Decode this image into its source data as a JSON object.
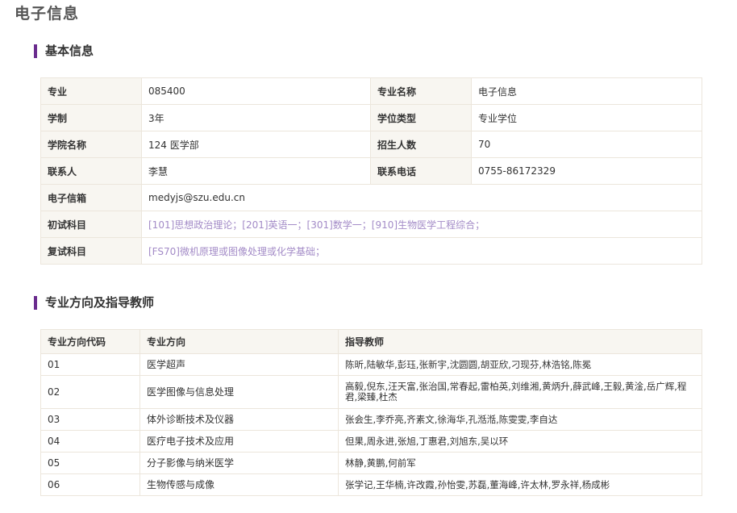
{
  "page": {
    "title": "电子信息"
  },
  "basic_info": {
    "section_title": "基本信息",
    "major_label": "专业",
    "major_value": "085400",
    "major_name_label": "专业名称",
    "major_name_value": "电子信息",
    "duration_label": "学制",
    "duration_value": "3年",
    "degree_type_label": "学位类型",
    "degree_type_value": "专业学位",
    "college_label": "学院名称",
    "college_value": "124 医学部",
    "enrollment_label": "招生人数",
    "enrollment_value": "70",
    "contact_label": "联系人",
    "contact_value": "李慧",
    "phone_label": "联系电话",
    "phone_value": "0755-86172329",
    "email_label": "电子信箱",
    "email_value": "medyjs@szu.edu.cn",
    "prelim_label": "初试科目",
    "prelim_subjects": "[101]思想政治理论；[201]英语一；[301]数学一；[910]生物医学工程综合；",
    "retest_label": "复试科目",
    "retest_subjects": "[FS70]微机原理或图像处理或化学基础；"
  },
  "directions": {
    "section_title": "专业方向及指导教师",
    "headers": [
      "专业方向代码",
      "专业方向",
      "指导教师"
    ],
    "rows": [
      {
        "code": "01",
        "name": "医学超声",
        "teachers": "陈昕,陆敏华,彭珏,张新宇,沈圆圆,胡亚欣,刁现芬,林浩铭,陈冕"
      },
      {
        "code": "02",
        "name": "医学图像与信息处理",
        "teachers": "高毅,倪东,汪天富,张治国,常春起,雷柏英,刘维湘,黄炳升,薛武峰,王毅,黄淦,岳广辉,程君,梁臻,杜杰"
      },
      {
        "code": "03",
        "name": "体外诊断技术及仪器",
        "teachers": "张会生,李乔亮,齐素文,徐海华,孔湉湉,陈雯雯,李自达"
      },
      {
        "code": "04",
        "name": "医疗电子技术及应用",
        "teachers": "但果,周永进,张旭,丁惠君,刘旭东,吴以环"
      },
      {
        "code": "05",
        "name": "分子影像与纳米医学",
        "teachers": "林静,黄鹏,何前军"
      },
      {
        "code": "06",
        "name": "生物传感与成像",
        "teachers": "张学记,王华楠,许改霞,孙怡雯,苏磊,董海峰,许太林,罗永祥,杨成彬"
      }
    ]
  }
}
